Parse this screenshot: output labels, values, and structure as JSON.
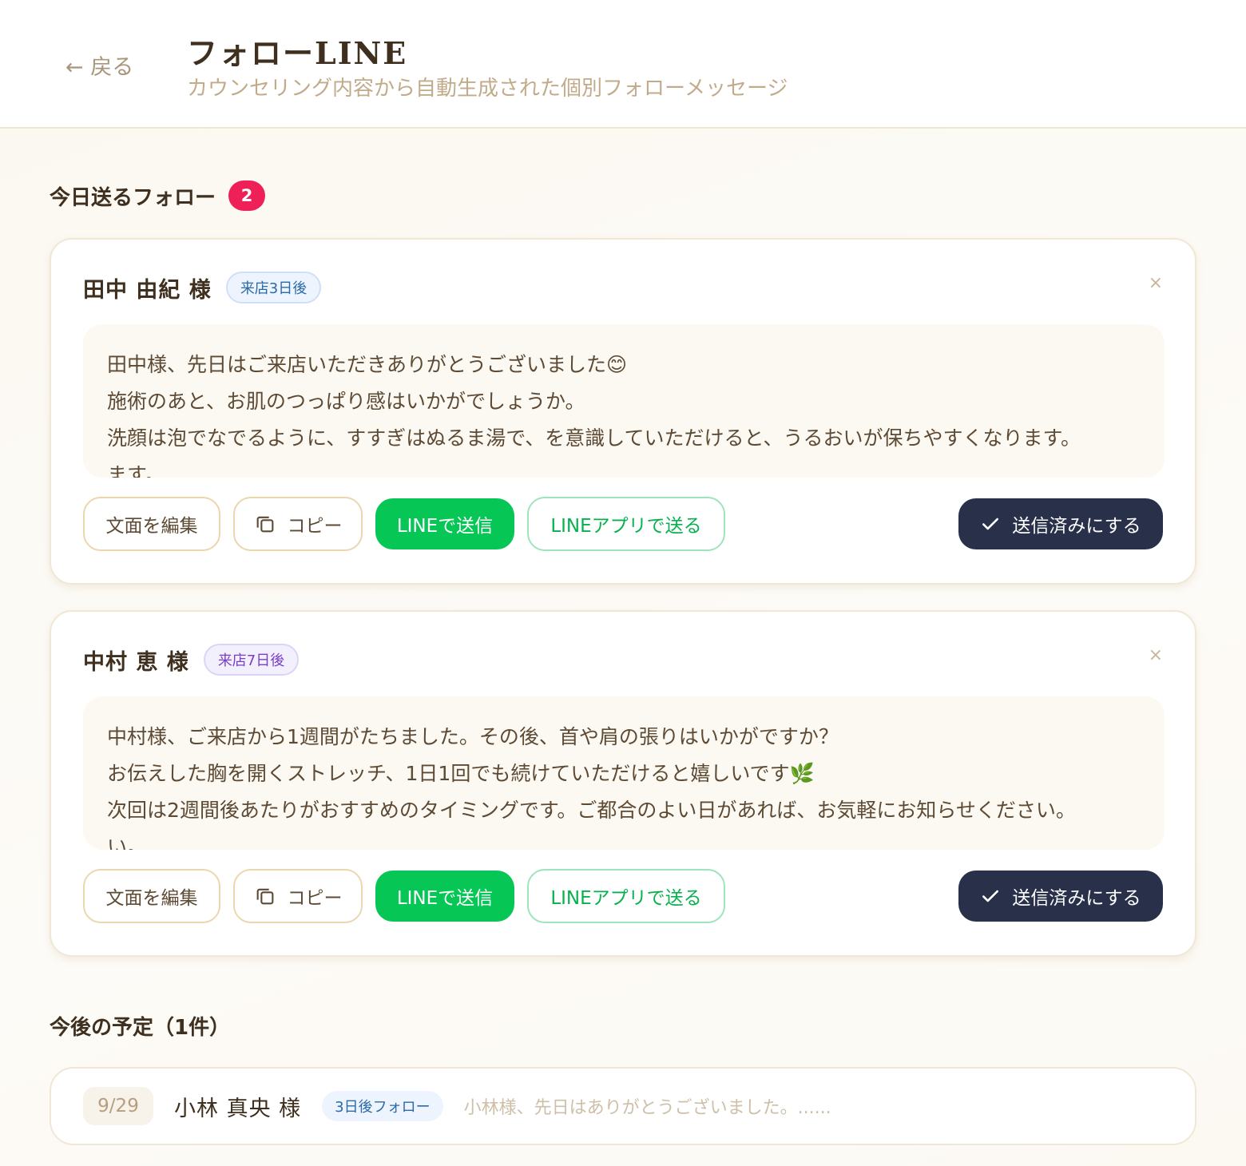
{
  "header": {
    "back_label": "← 戻る",
    "title": "フォローLINE",
    "subtitle": "カウンセリング内容から自動生成された個別フォローメッセージ"
  },
  "today": {
    "title": "今日送るフォロー",
    "count": "2",
    "cards": [
      {
        "name": "田中 由紀 様",
        "tag": "来店3日後",
        "close": "×",
        "message_lines": [
          "田中様、先日はご来店いただきありがとうございました😊",
          "施術のあと、お肌のつっぱり感はいかがでしょうか。",
          "洗顔は泡でなでるように、すすぎはぬるま湯で、を意識していただけると、うるおいが保ちやすくなります。",
          "ます。"
        ]
      },
      {
        "name": "中村 恵 様",
        "tag": "来店7日後",
        "close": "×",
        "message_lines": [
          "中村様、ご来店から1週間がたちました。その後、首や肩の張りはいかがですか？",
          "お伝えした胸を開くストレッチ、1日1回でも続けていただけると嬉しいです🌿",
          "次回は2週間後あたりがおすすめのタイミングです。ご都合のよい日があれば、お気軽にお知らせください。",
          "い。"
        ]
      }
    ],
    "buttons": {
      "edit": "文面を編集",
      "copy": "コピー",
      "send_line": "LINEで送信",
      "send_app": "LINEアプリで送る",
      "mark_sent": "送信済みにする"
    }
  },
  "upcoming": {
    "title": "今後の予定（1件）",
    "items": [
      {
        "date": "9/29",
        "name": "小林 真央 様",
        "tag": "3日後フォロー",
        "preview": "小林様、先日はありがとうございました。......"
      }
    ]
  }
}
